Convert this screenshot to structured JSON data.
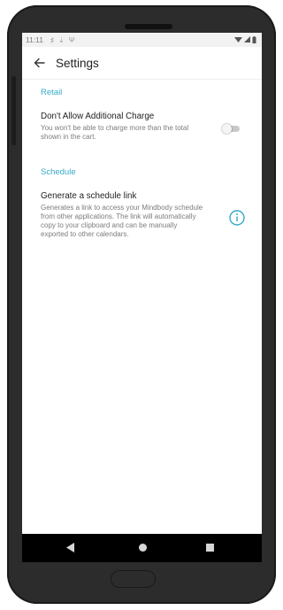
{
  "status_bar": {
    "time": "11:11"
  },
  "app_bar": {
    "title": "Settings"
  },
  "sections": {
    "retail": {
      "header": "Retail",
      "item": {
        "title": "Don't Allow Additional Charge",
        "description_lines": [
          "You won't be able to charge more than the total",
          "shown in the cart."
        ],
        "toggle_on": false
      }
    },
    "schedule": {
      "header": "Schedule",
      "item": {
        "title": "Generate a schedule link",
        "description_lines": [
          "Generates a link to access your Mindbody schedule",
          "from other applications. The link will automatically",
          "copy to your clipboard and can be manually",
          "exported to other calendars."
        ]
      }
    }
  },
  "colors": {
    "accent": "#36a9c9",
    "navbar": "#000000",
    "phone_frame": "#2c2c2c"
  },
  "icons": {
    "back": "arrow-left-icon",
    "info": "info-circle-icon",
    "nav_back": "triangle-back-icon",
    "nav_home": "circle-home-icon",
    "nav_recent": "square-recents-icon"
  }
}
